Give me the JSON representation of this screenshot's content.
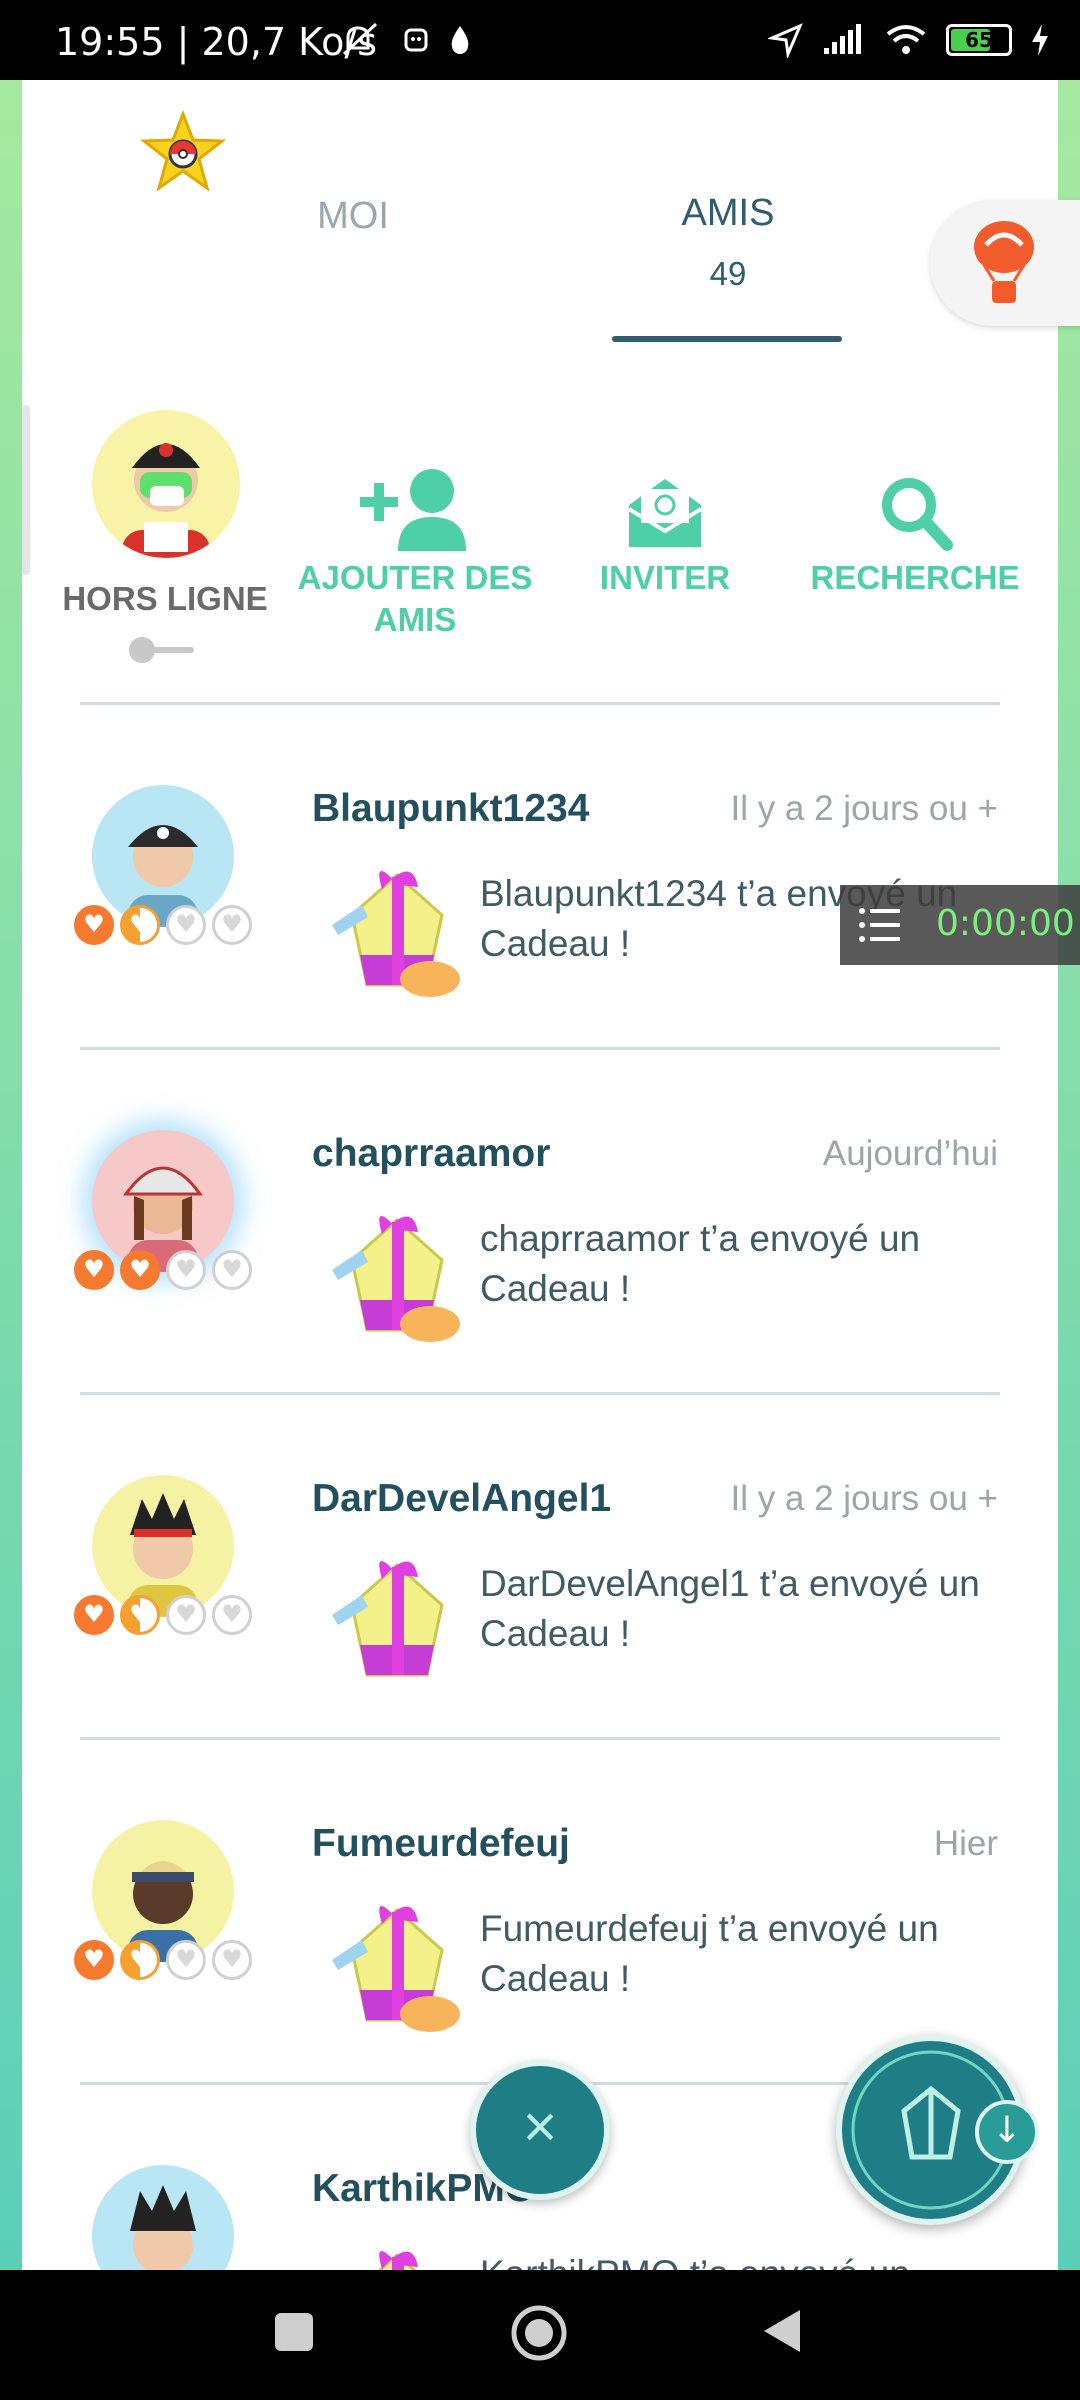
{
  "status_bar": {
    "time_speed": "19:55 | 20,7 Ko/s",
    "battery_level": "65",
    "colors": {
      "battery": "#4ad04a"
    }
  },
  "tabs": {
    "me_label": "MOI",
    "friends_label": "AMIS",
    "friends_count": "49"
  },
  "profile": {
    "status_label": "HORS LIGNE"
  },
  "actions": {
    "add_friends": "AJOUTER DES AMIS",
    "invite": "INVITER",
    "search": "RECHERCHE"
  },
  "friends": [
    {
      "name": "Blaupunkt1234",
      "time": "Il y a 2 jours ou +",
      "message": "Blaupunkt1234 t’a envoyé un Cadeau !",
      "hearts": [
        "on",
        "half",
        "off",
        "off"
      ]
    },
    {
      "name": "chaprraamor",
      "time": "Aujourd’hui",
      "message": "chaprraamor t’a envoyé un Cadeau !",
      "hearts": [
        "on",
        "on",
        "off",
        "off"
      ]
    },
    {
      "name": "DarDevelAngel1",
      "time": "Il y a 2 jours ou +",
      "message": "DarDevelAngel1 t’a envoyé un Cadeau !",
      "hearts": [
        "on",
        "half",
        "off",
        "off"
      ]
    },
    {
      "name": "Fumeurdefeuj",
      "time": "Hier",
      "message": "Fumeurdefeuj t’a envoyé un Cadeau !",
      "hearts": [
        "on",
        "half",
        "off",
        "off"
      ]
    },
    {
      "name": "KarthikPMO",
      "time": "",
      "message": "KarthikPMO t’a envoyé un Cadeau !",
      "hearts": []
    }
  ],
  "recorder": {
    "timer": "0:00:00"
  },
  "colors": {
    "accent": "#4ecfa5",
    "title": "#23505f",
    "fab": "#1f7d86"
  }
}
